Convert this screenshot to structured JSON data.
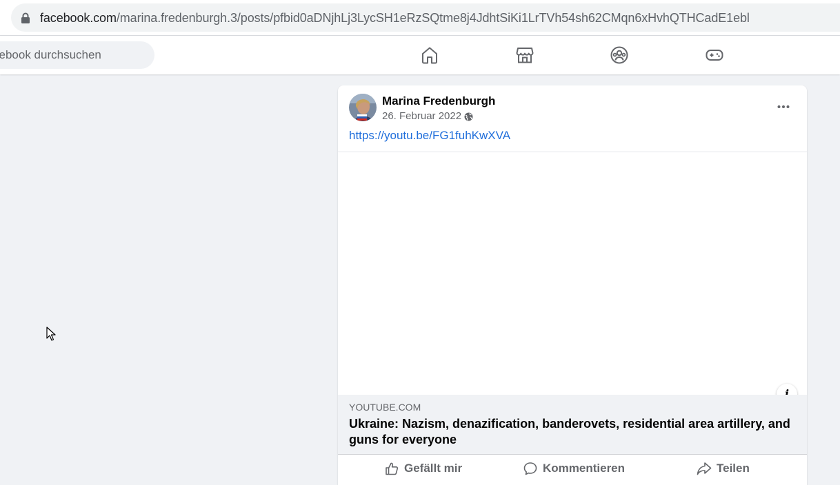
{
  "browser": {
    "url_domain": "facebook.com",
    "url_path": "/marina.fredenburgh.3/posts/pfbid0aDNjhLj3LycSH1eRzSQtme8j4JdhtSiKi1LrTVh54sh62CMqn6xHvhQTHCadE1ebl"
  },
  "topbar": {
    "search_placeholder": "cebook durchsuchen",
    "nav_icons": [
      "home-icon",
      "marketplace-icon",
      "groups-icon",
      "gaming-icon"
    ]
  },
  "post": {
    "author": "Marina Fredenburgh",
    "date": "26. Februar 2022 ·",
    "link": "https://youtu.be/FG1fuhKwXVA",
    "preview": {
      "domain": "YOUTUBE.COM",
      "title": "Ukraine: Nazism, denazification, banderovets, residential area artillery, and guns for everyone"
    },
    "actions": {
      "like": "Gefällt mir",
      "comment": "Kommentieren",
      "share": "Teilen"
    }
  },
  "colors": {
    "link": "#216fdb",
    "background": "#f0f2f5",
    "secondary_text": "#65676b"
  }
}
